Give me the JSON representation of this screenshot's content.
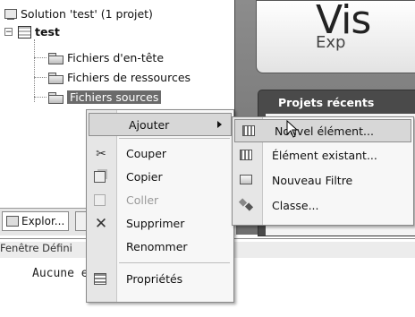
{
  "tree": {
    "solution_label": "Solution 'test' (1 projet)",
    "project_label": "test",
    "expander": "−",
    "folders": [
      "Fichiers d'en-tête",
      "Fichiers de ressources",
      "Fichiers sources"
    ]
  },
  "start_page": {
    "title": "Vis",
    "subtitle": "Exp",
    "recent_projects_label": "Projets récents"
  },
  "bottom": {
    "explorer_tab_label": "Explor...",
    "definition_panel_title": "Fenêtre Défini",
    "definition_text": "Aucune                 ectionnée"
  },
  "context_menu": {
    "items": [
      {
        "label": "Ajouter",
        "icon": "",
        "submenu": true
      },
      {
        "label": "Couper",
        "icon": "scissors-icon"
      },
      {
        "label": "Copier",
        "icon": "copy-icon"
      },
      {
        "label": "Coller",
        "icon": "paste-icon",
        "disabled": true
      },
      {
        "label": "Supprimer",
        "icon": "delete-icon"
      },
      {
        "label": "Renommer",
        "icon": ""
      },
      {
        "label": "Propriétés",
        "icon": "properties-icon"
      }
    ]
  },
  "submenu": {
    "items": [
      {
        "label": "Nouvel élément...",
        "icon": "new-item-icon",
        "hover": true
      },
      {
        "label": "Élément existant...",
        "icon": "existing-item-icon"
      },
      {
        "label": "Nouveau Filtre",
        "icon": "new-folder-icon"
      },
      {
        "label": "Classe...",
        "icon": "class-icon"
      }
    ]
  }
}
